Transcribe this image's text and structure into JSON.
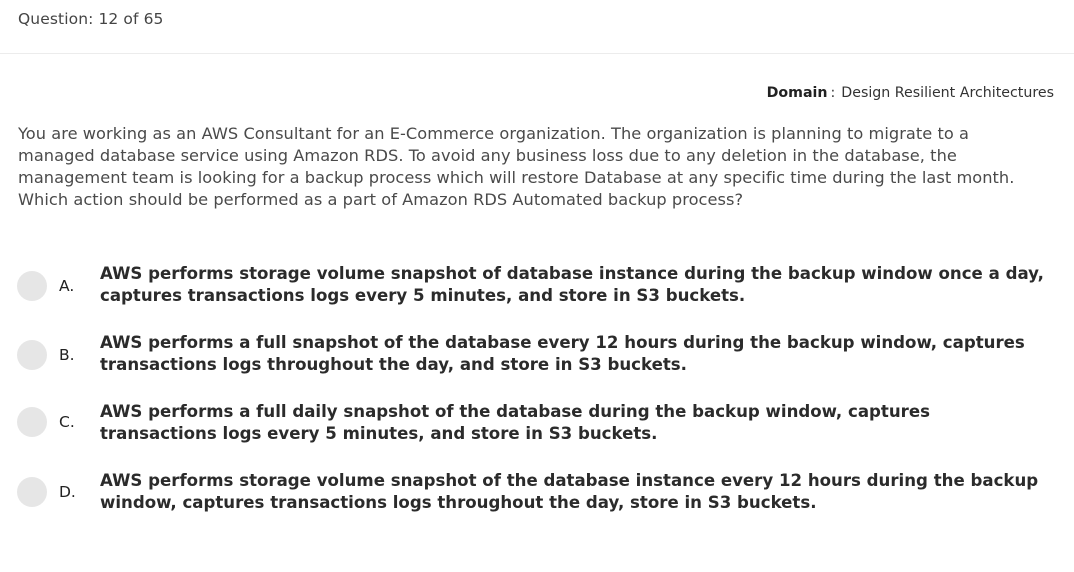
{
  "header": {
    "question_counter": "Question: 12 of 65"
  },
  "domain": {
    "label": "Domain",
    "separator": ":",
    "value": "Design Resilient Architectures"
  },
  "question": {
    "text": "You are working as an AWS Consultant for an E-Commerce organization. The organization is planning to migrate to a managed database service using Amazon RDS. To avoid any business loss due to any deletion in the database, the management team is looking for a backup process which will restore Database at any specific time during the last month. Which action should be performed as a part of Amazon RDS Automated backup process?"
  },
  "options": [
    {
      "letter": "A.",
      "text": "AWS performs storage volume snapshot of database instance during the backup window once a day, captures transactions logs every 5 minutes, and store in S3 buckets."
    },
    {
      "letter": "B.",
      "text": "AWS performs a full snapshot of the database every 12 hours during the backup window, captures transactions logs throughout the day, and store in S3 buckets."
    },
    {
      "letter": "C.",
      "text": "AWS performs a full daily snapshot of the database during the backup window, captures transactions logs every 5 minutes, and store in S3 buckets."
    },
    {
      "letter": "D.",
      "text": "AWS performs storage volume snapshot of the database instance every 12 hours during the backup window, captures transactions logs throughout the day, store in S3 buckets."
    }
  ]
}
